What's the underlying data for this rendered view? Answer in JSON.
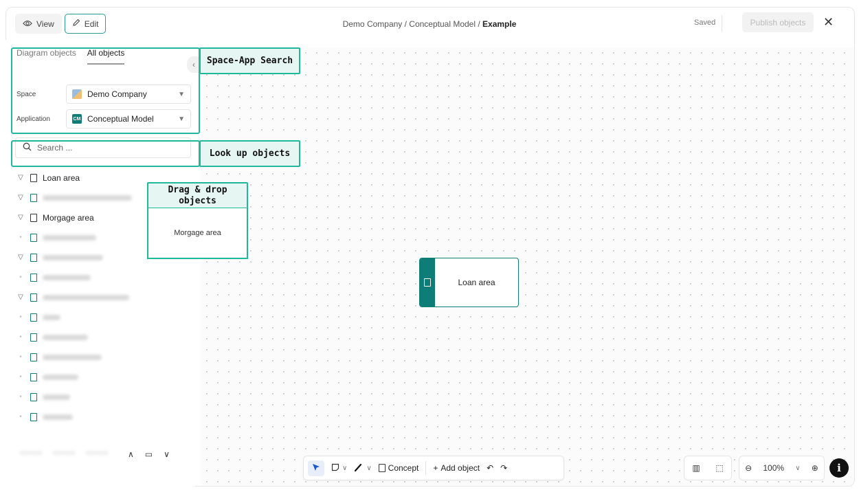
{
  "header": {
    "view_label": "View",
    "edit_label": "Edit",
    "breadcrumb_prefix": "Demo Company / Conceptual Model / ",
    "breadcrumb_current": "Example",
    "saved_label": "Saved",
    "publish_label": "Publish objects",
    "close_icon": "close-icon"
  },
  "panel": {
    "tabs": [
      {
        "label": "Diagram objects",
        "active": false
      },
      {
        "label": "All objects",
        "active": true
      }
    ],
    "space_label": "Space",
    "space_value": "Demo Company",
    "application_label": "Application",
    "application_icon_text": "CM",
    "application_value": "Conceptual Model",
    "search_placeholder": "Search ...",
    "tree": [
      {
        "label": "Loan area",
        "expanded": true
      },
      {
        "label": "",
        "expanded": true
      },
      {
        "label": "Morgage area",
        "expanded": true
      }
    ]
  },
  "annotations": {
    "space_app": "Space-App Search",
    "lookup": "Look up objects",
    "drag_drop": "Drag & drop objects",
    "drag_card": "Morgage area"
  },
  "canvas": {
    "node_label": "Loan area"
  },
  "toolbar": {
    "concept_label": "Concept",
    "add_object_label": "Add object",
    "zoom_value": "100%"
  },
  "colors": {
    "accent": "#0e7c77",
    "highlight": "#1fb89a",
    "select_blue": "#1a56c9"
  }
}
